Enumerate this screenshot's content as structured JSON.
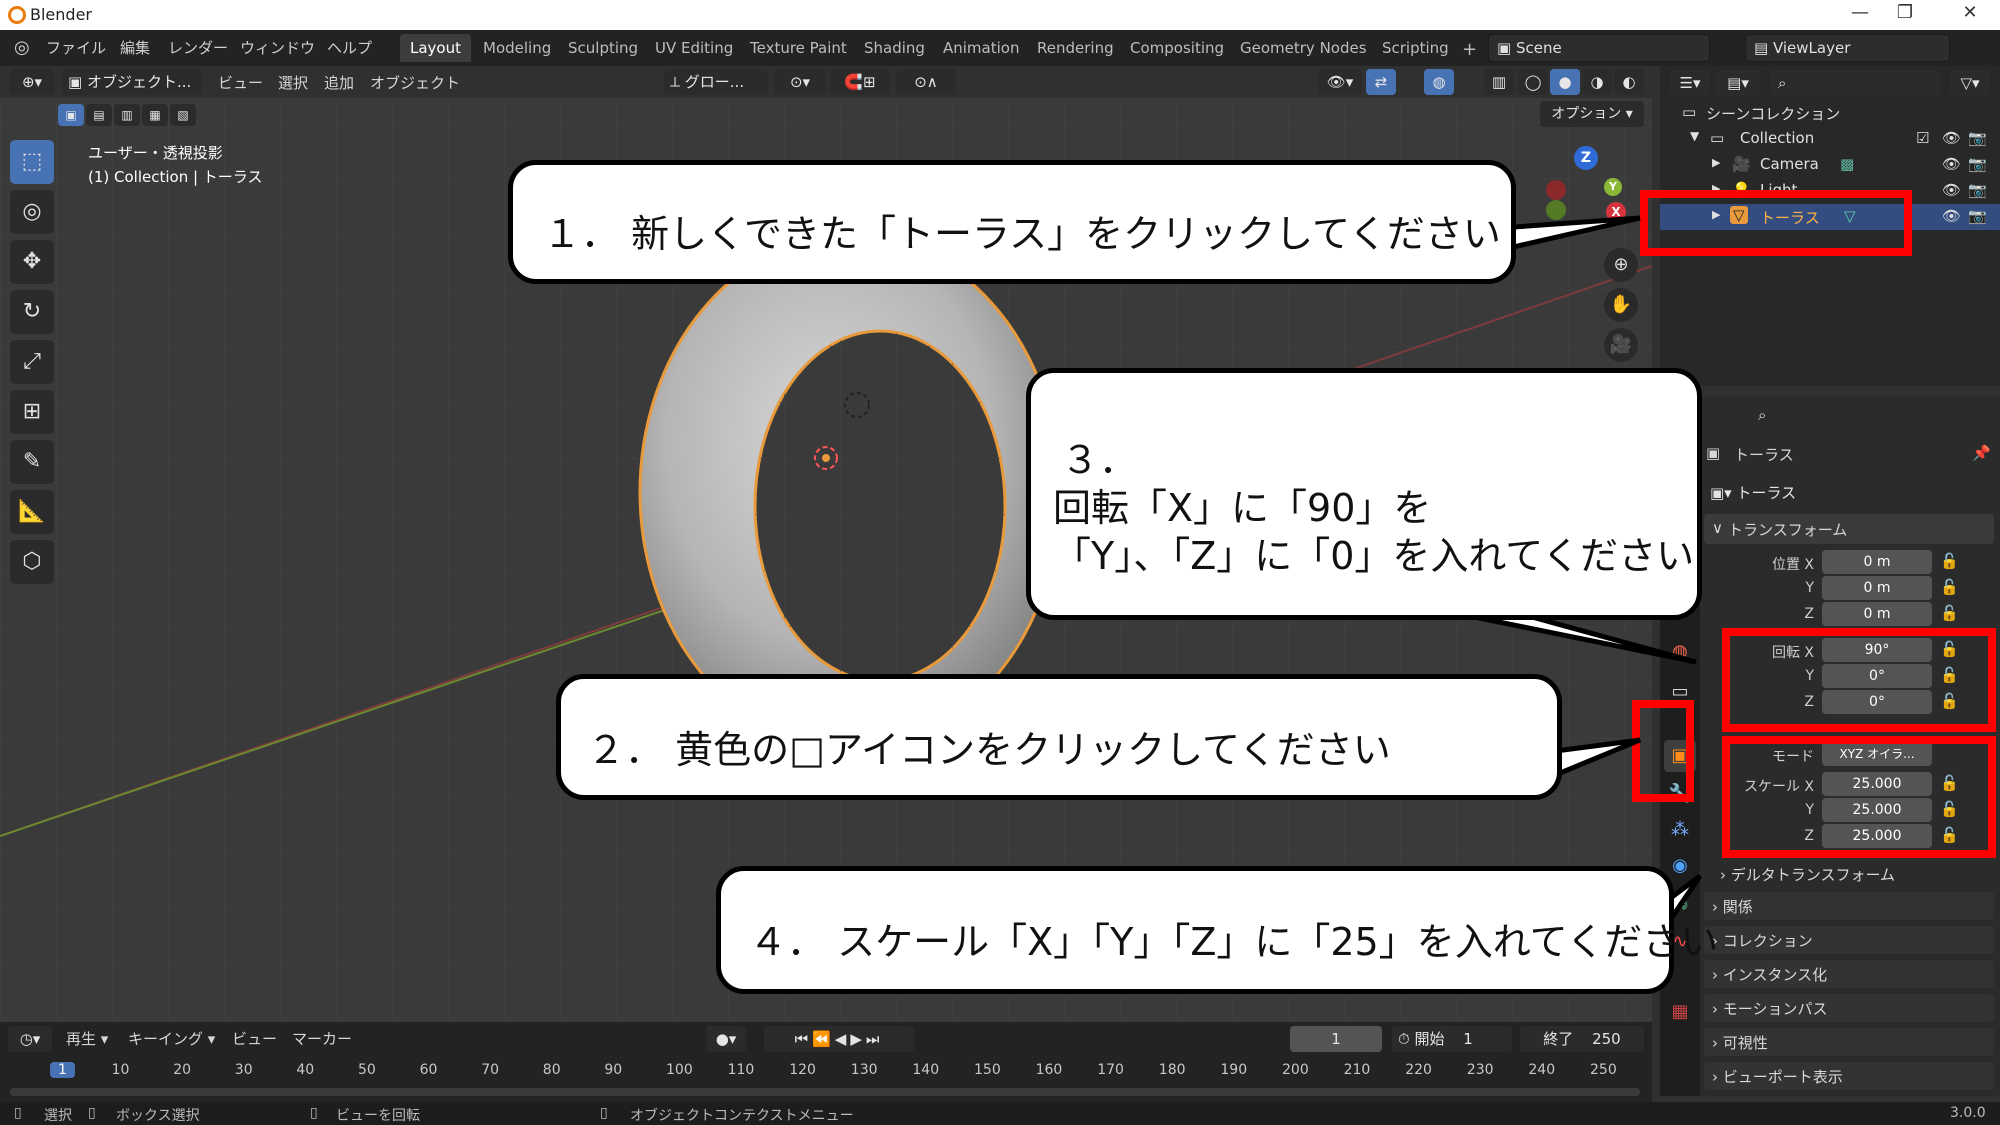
{
  "titlebar": {
    "title": "Blender",
    "minimize": "—",
    "maximize": "❐",
    "close": "✕"
  },
  "menu": [
    "ファイル",
    "編集",
    "レンダー",
    "ウィンドウ",
    "ヘルプ"
  ],
  "workspaces": [
    "Layout",
    "Modeling",
    "Sculpting",
    "UV Editing",
    "Texture Paint",
    "Shading",
    "Animation",
    "Rendering",
    "Compositing",
    "Geometry Nodes",
    "Scripting"
  ],
  "workspace_add": "+",
  "scene": {
    "label": "Scene",
    "viewlayer": "ViewLayer"
  },
  "viewport_header": {
    "mode": "オブジェクト...",
    "menus": [
      "ビュー",
      "選択",
      "追加",
      "オブジェクト"
    ],
    "transform": "グロー...",
    "options": "オプション"
  },
  "viewport": {
    "view_name": "ユーザー・透視投影",
    "collection_info": "(1) Collection | トーラス"
  },
  "gizmo": {
    "x": "X",
    "y": "Y",
    "z": "Z"
  },
  "outliner": {
    "scene_collection": "シーンコレクション",
    "collection": "Collection",
    "camera": "Camera",
    "light": "Light",
    "torus": "トーラス"
  },
  "properties": {
    "object_name": "トーラス",
    "object_name2": "トーラス",
    "transform_title": "トランスフォーム",
    "location_label": "位置 X",
    "location": [
      "0 m",
      "0 m",
      "0 m"
    ],
    "rotation_label": "回転 X",
    "rotation": [
      "90°",
      "0°",
      "0°"
    ],
    "mode_label": "モード",
    "mode_value": "XYZ オイラ...",
    "scale_label": "スケール X",
    "scale": [
      "25.000",
      "25.000",
      "25.000"
    ],
    "axis_y": "Y",
    "axis_z": "Z",
    "panels": [
      "デルタトランスフォーム",
      "関係",
      "コレクション",
      "インスタンス化",
      "モーションパス",
      "可視性",
      "ビューポート表示"
    ]
  },
  "timeline": {
    "play_label": "再生",
    "keying": "キーイング",
    "view": "ビュー",
    "marker": "マーカー",
    "current_frame": "1",
    "start_label": "開始",
    "start": "1",
    "end_label": "終了",
    "end": "250",
    "ticks": [
      "1",
      "10",
      "20",
      "30",
      "40",
      "50",
      "60",
      "70",
      "80",
      "90",
      "100",
      "110",
      "120",
      "130",
      "140",
      "150",
      "160",
      "170",
      "180",
      "190",
      "200",
      "210",
      "220",
      "230",
      "240",
      "250"
    ]
  },
  "statusbar": {
    "select": "選択",
    "box_select": "ボックス選択",
    "rotate_view": "ビューを回転",
    "context_menu": "オブジェクトコンテクストメニュー",
    "version": "3.0.0"
  },
  "callouts": {
    "step1": "１． 新しくできた「トーラス」をクリックしてください",
    "step2": "２． 黄色の□アイコンをクリックしてください",
    "step3_num": "３．",
    "step3_line1": "回転「X」に「90」を",
    "step3_line2": "「Y」、「Z」に「0」を入れてください",
    "step4": "４． スケール「X」「Y」「Z」に「25」を入れてください"
  },
  "colors": {
    "accent_blue": "#4772b3",
    "selected_row": "#334d80",
    "object_orange": "#e89a3c",
    "callout_border": "#000000",
    "highlight_red": "#ff0000"
  }
}
